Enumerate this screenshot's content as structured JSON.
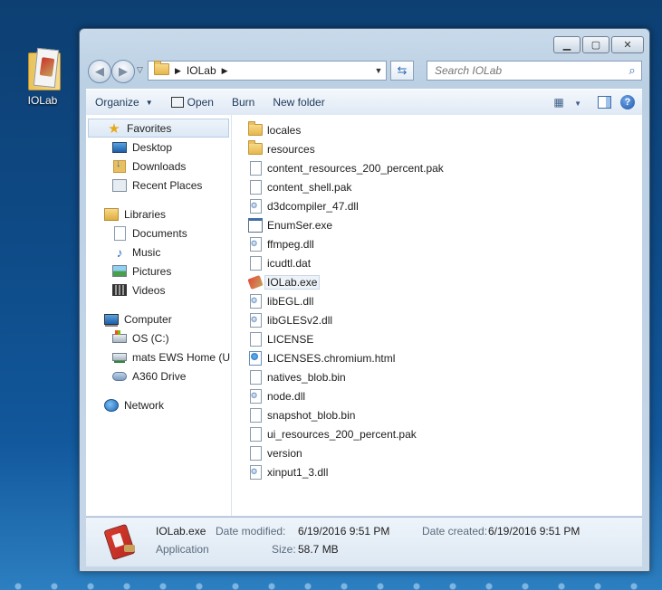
{
  "desktop": {
    "icon_label": "IOLab"
  },
  "window": {
    "address": {
      "crumbs": [
        "IOLab"
      ]
    },
    "search": {
      "placeholder": "Search IOLab"
    },
    "toolbar": {
      "organize": "Organize",
      "open": "Open",
      "burn": "Burn",
      "new_folder": "New folder"
    },
    "nav": {
      "favorites": {
        "label": "Favorites",
        "items": [
          "Desktop",
          "Downloads",
          "Recent Places"
        ]
      },
      "libraries": {
        "label": "Libraries",
        "items": [
          "Documents",
          "Music",
          "Pictures",
          "Videos"
        ]
      },
      "computer": {
        "label": "Computer",
        "items": [
          "OS (C:)",
          "mats EWS Home (U:",
          "A360 Drive"
        ]
      },
      "network": {
        "label": "Network"
      }
    },
    "files": [
      {
        "name": "locales",
        "icon": "folder-icon"
      },
      {
        "name": "resources",
        "icon": "folder-icon"
      },
      {
        "name": "content_resources_200_percent.pak",
        "icon": "file-icon"
      },
      {
        "name": "content_shell.pak",
        "icon": "file-icon"
      },
      {
        "name": "d3dcompiler_47.dll",
        "icon": "dll-icon"
      },
      {
        "name": "EnumSer.exe",
        "icon": "exe-icon"
      },
      {
        "name": "ffmpeg.dll",
        "icon": "dll-icon"
      },
      {
        "name": "icudtl.dat",
        "icon": "file-icon"
      },
      {
        "name": "IOLab.exe",
        "icon": "iolab-app-icon"
      },
      {
        "name": "libEGL.dll",
        "icon": "dll-icon"
      },
      {
        "name": "libGLESv2.dll",
        "icon": "dll-icon"
      },
      {
        "name": "LICENSE",
        "icon": "file-icon"
      },
      {
        "name": "LICENSES.chromium.html",
        "icon": "html-icon"
      },
      {
        "name": "natives_blob.bin",
        "icon": "file-icon"
      },
      {
        "name": "node.dll",
        "icon": "dll-icon"
      },
      {
        "name": "snapshot_blob.bin",
        "icon": "file-icon"
      },
      {
        "name": "ui_resources_200_percent.pak",
        "icon": "file-icon"
      },
      {
        "name": "version",
        "icon": "file-icon"
      },
      {
        "name": "xinput1_3.dll",
        "icon": "dll-icon"
      }
    ],
    "details": {
      "name": "IOLab.exe",
      "type": "Application",
      "date_modified_label": "Date modified:",
      "date_modified": "6/19/2016 9:51 PM",
      "date_created_label": "Date created:",
      "date_created": "6/19/2016 9:51 PM",
      "size_label": "Size:",
      "size": "58.7 MB"
    }
  }
}
